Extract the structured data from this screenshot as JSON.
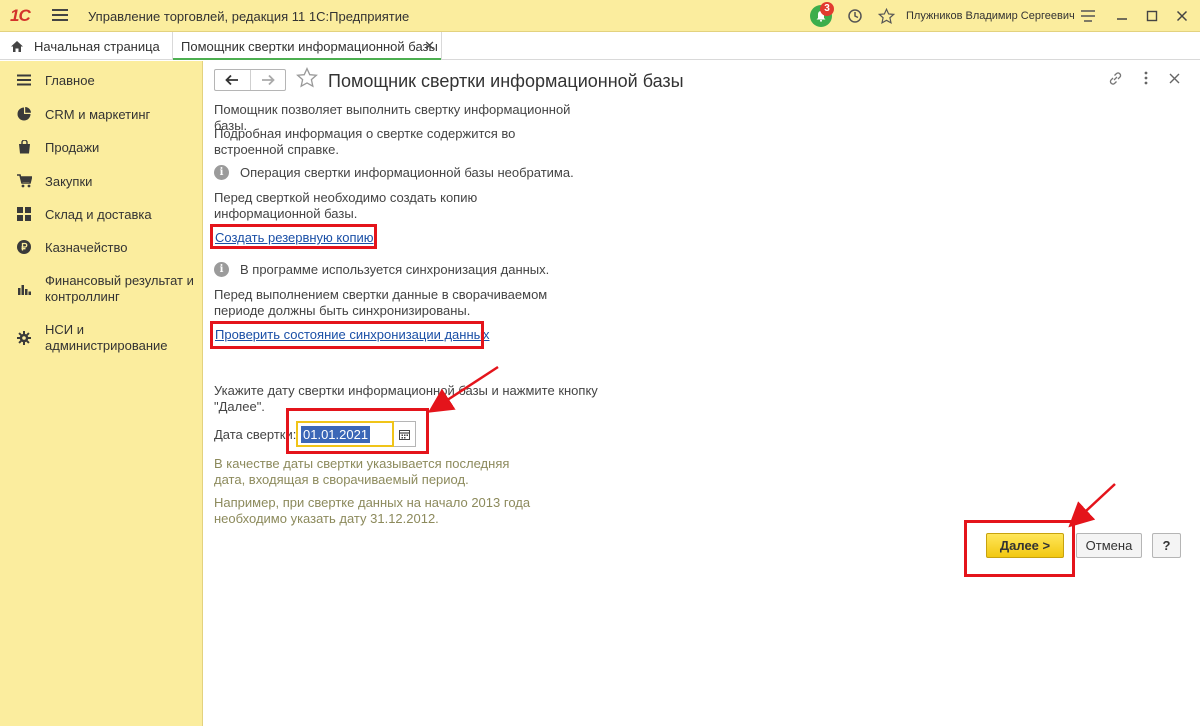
{
  "titlebar": {
    "logo": "1С",
    "app_title": "Управление торговлей, редакция 11 1С:Предприятие",
    "notification_count": "3",
    "user_name": "Плужников Владимир Сергеевич"
  },
  "tabs": {
    "home": "Начальная страница",
    "active": "Помощник свертки информационной базы"
  },
  "sidebar": {
    "items": [
      {
        "label": "Главное",
        "icon": "menu-lines-icon"
      },
      {
        "label": "CRM и маркетинг",
        "icon": "pie-chart-icon"
      },
      {
        "label": "Продажи",
        "icon": "shopping-bag-icon"
      },
      {
        "label": "Закупки",
        "icon": "cart-icon"
      },
      {
        "label": "Склад и доставка",
        "icon": "warehouse-grid-icon"
      },
      {
        "label": "Казначейство",
        "icon": "ruble-coin-icon"
      },
      {
        "label": "Финансовый результат и контроллинг",
        "icon": "bar-chart-icon"
      },
      {
        "label": "НСИ и администрирование",
        "icon": "gear-icon"
      }
    ]
  },
  "form": {
    "title": "Помощник свертки информационной базы",
    "intro": "Помощник позволяет выполнить свертку информационной базы.",
    "help_note": "Подробная информация о свертке содержится во встроенной справке.",
    "irreversible": "Операция свертки информационной базы необратима.",
    "backup_note": "Перед сверткой необходимо создать копию информационной базы.",
    "backup_link": "Создать резервную копию",
    "sync_used": "В программе используется синхронизация данных.",
    "sync_note": "Перед выполнением свертки данные в сворачиваемом периоде должны быть синхронизированы.",
    "sync_link": "Проверить состояние синхронизации данных",
    "date_prompt": "Укажите дату свертки информационной базы и нажмите кнопку \"Далее\".",
    "date_label": "Дата свертки:",
    "date_value": "01.01.2021",
    "hint1": "В качестве даты свертки указывается последняя дата, входящая в сворачиваемый период.",
    "hint2": "Например, при свертке данных на начало 2013 года необходимо указать дату 31.12.2012.",
    "next_button": "Далее >",
    "cancel_button": "Отмена",
    "help_button": "?"
  },
  "colors": {
    "accent_yellow": "#fbed9e",
    "annotation_red": "#e4141b",
    "link_blue": "#1a4fa6",
    "selection_blue": "#3b67b7"
  }
}
